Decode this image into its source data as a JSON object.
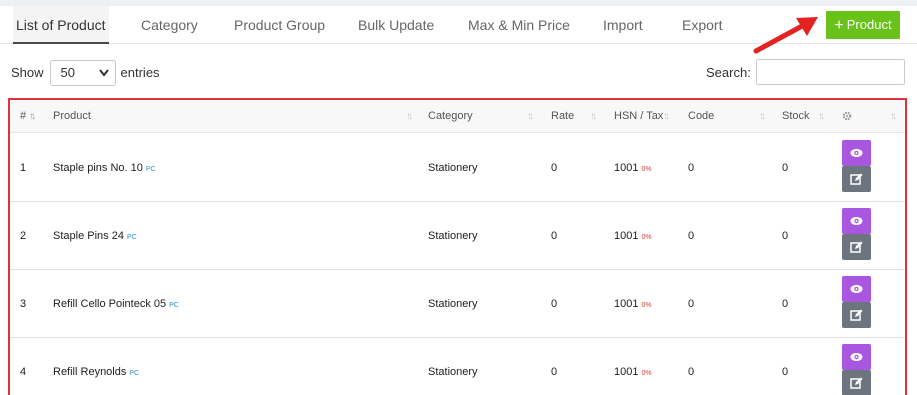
{
  "tabs": [
    {
      "label": "List of Product",
      "active": true
    },
    {
      "label": "Category"
    },
    {
      "label": "Product Group"
    },
    {
      "label": "Bulk Update"
    },
    {
      "label": "Max & Min Price"
    },
    {
      "label": "Import"
    },
    {
      "label": "Export"
    }
  ],
  "add_button": {
    "icon": "plus-icon",
    "label": "Product",
    "color": "#68c21a"
  },
  "length_menu": {
    "prefix": "Show",
    "value": "50",
    "suffix": "entries"
  },
  "search": {
    "label": "Search:",
    "value": ""
  },
  "table": {
    "border_color": "#e0303a",
    "columns": {
      "index": "#",
      "product": "Product",
      "category": "Category",
      "rate": "Rate",
      "hsn_tax": "HSN / Tax",
      "code": "Code",
      "stock": "Stock",
      "settings_icon": "gear-icon"
    },
    "rows": [
      {
        "index": "1",
        "product": "Staple pins No. 10",
        "unit": "PC",
        "category": "Stationery",
        "rate": "0",
        "hsn": "1001",
        "tax": "0%",
        "code": "0",
        "stock": "0"
      },
      {
        "index": "2",
        "product": "Staple Pins 24",
        "unit": "PC",
        "category": "Stationery",
        "rate": "0",
        "hsn": "1001",
        "tax": "0%",
        "code": "0",
        "stock": "0"
      },
      {
        "index": "3",
        "product": "Refill Cello Pointeck 05",
        "unit": "PC",
        "category": "Stationery",
        "rate": "0",
        "hsn": "1001",
        "tax": "0%",
        "code": "0",
        "stock": "0"
      },
      {
        "index": "4",
        "product": "Refill Reynolds",
        "unit": "PC",
        "category": "Stationery",
        "rate": "0",
        "hsn": "1001",
        "tax": "0%",
        "code": "0",
        "stock": "0"
      }
    ],
    "actions": {
      "view_icon": "eye-icon",
      "edit_icon": "edit-icon",
      "view_color": "#a957e0",
      "edit_color": "#6c757d"
    }
  }
}
